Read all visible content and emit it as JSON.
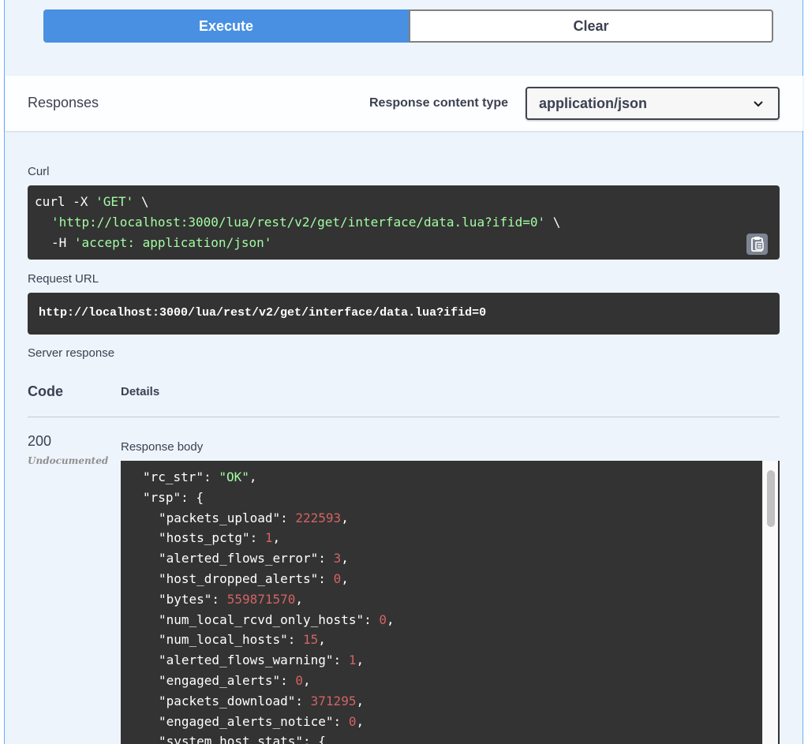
{
  "actions": {
    "execute_label": "Execute",
    "clear_label": "Clear"
  },
  "responses": {
    "title": "Responses",
    "content_type_label": "Response content type",
    "content_type_value": "application/json",
    "chevron_icon": "chevron-down-icon"
  },
  "curl": {
    "label": "Curl",
    "line1_cmd": "curl -X ",
    "line1_method": "'GET'",
    "line1_tail": " \\",
    "line2_url": "'http://localhost:3000/lua/rest/v2/get/interface/data.lua?ifid=0'",
    "line2_tail": " \\",
    "line3_flag": "-H ",
    "line3_header": "'accept: application/json'",
    "copy_icon": "clipboard-copy-icon"
  },
  "request_url": {
    "label": "Request URL",
    "value": "http://localhost:3000/lua/rest/v2/get/interface/data.lua?ifid=0"
  },
  "server_response": {
    "label": "Server response",
    "col_code": "Code",
    "col_details": "Details",
    "code": "200",
    "code_note": "Undocumented",
    "body_label": "Response body",
    "body_lines": [
      {
        "key": "\"rc_str\": ",
        "value": "\"OK\"",
        "kind": "string",
        "tail": ",",
        "indent": 1
      },
      {
        "key": "\"rsp\": {",
        "value": "",
        "kind": "none",
        "tail": "",
        "indent": 1
      },
      {
        "key": "\"packets_upload\": ",
        "value": "222593",
        "kind": "number",
        "tail": ",",
        "indent": 2
      },
      {
        "key": "\"hosts_pctg\": ",
        "value": "1",
        "kind": "number",
        "tail": ",",
        "indent": 2
      },
      {
        "key": "\"alerted_flows_error\": ",
        "value": "3",
        "kind": "number",
        "tail": ",",
        "indent": 2
      },
      {
        "key": "\"host_dropped_alerts\": ",
        "value": "0",
        "kind": "number",
        "tail": ",",
        "indent": 2
      },
      {
        "key": "\"bytes\": ",
        "value": "559871570",
        "kind": "number",
        "tail": ",",
        "indent": 2
      },
      {
        "key": "\"num_local_rcvd_only_hosts\": ",
        "value": "0",
        "kind": "number",
        "tail": ",",
        "indent": 2
      },
      {
        "key": "\"num_local_hosts\": ",
        "value": "15",
        "kind": "number",
        "tail": ",",
        "indent": 2
      },
      {
        "key": "\"alerted_flows_warning\": ",
        "value": "1",
        "kind": "number",
        "tail": ",",
        "indent": 2
      },
      {
        "key": "\"engaged_alerts\": ",
        "value": "0",
        "kind": "number",
        "tail": ",",
        "indent": 2
      },
      {
        "key": "\"packets_download\": ",
        "value": "371295",
        "kind": "number",
        "tail": ",",
        "indent": 2
      },
      {
        "key": "\"engaged_alerts_notice\": ",
        "value": "0",
        "kind": "number",
        "tail": ",",
        "indent": 2
      },
      {
        "key": "\"system_host_stats\": {",
        "value": "",
        "kind": "none",
        "tail": "",
        "indent": 2
      }
    ]
  }
}
